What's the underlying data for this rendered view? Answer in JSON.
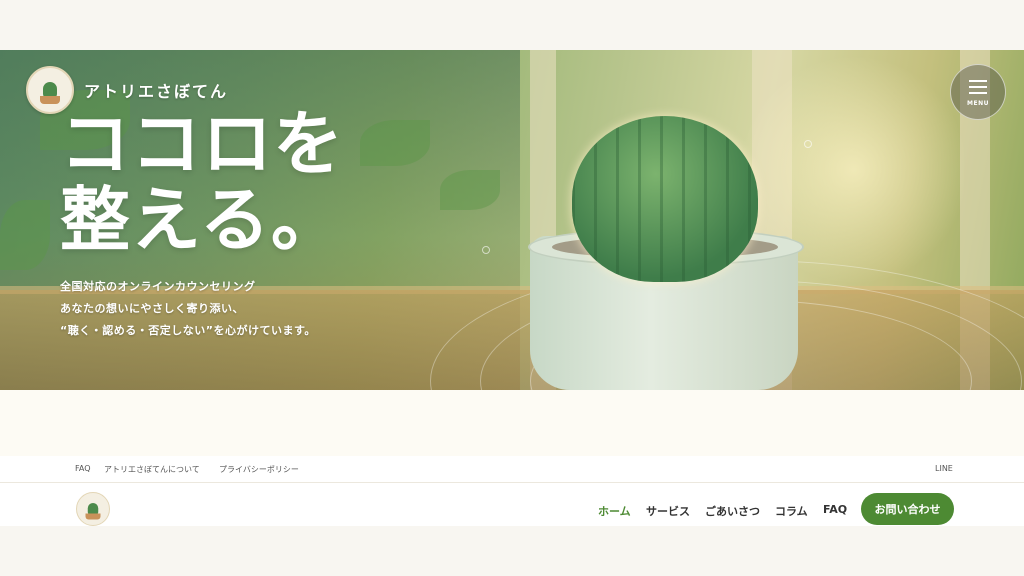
{
  "brand": {
    "name": "アトリエさぼてん"
  },
  "hero": {
    "headline_line1": "ココロを",
    "headline_line2": "整える。",
    "lead_line1": "全国対応のオンラインカウンセリング",
    "lead_line2": "あなたの想いにやさしく寄り添い、",
    "lead_line3": "“聴く・認める・否定しない”を心がけています。"
  },
  "menu": {
    "label": "MENU",
    "icon": "hamburger-icon"
  },
  "sub_links": [
    {
      "label": "FAQ"
    },
    {
      "label": "アトリエさぼてんについて"
    },
    {
      "label": "プライバシーポリシー"
    }
  ],
  "sub_right": {
    "label": "LINE"
  },
  "nav": {
    "items": [
      {
        "label": "ホーム",
        "active": true
      },
      {
        "label": "サービス"
      },
      {
        "label": "ごあいさつ"
      },
      {
        "label": "コラム"
      },
      {
        "label": "FAQ"
      }
    ],
    "contact_label": "お問い合わせ"
  },
  "colors": {
    "accent": "#4d8a33",
    "background": "#f8f6f1"
  }
}
